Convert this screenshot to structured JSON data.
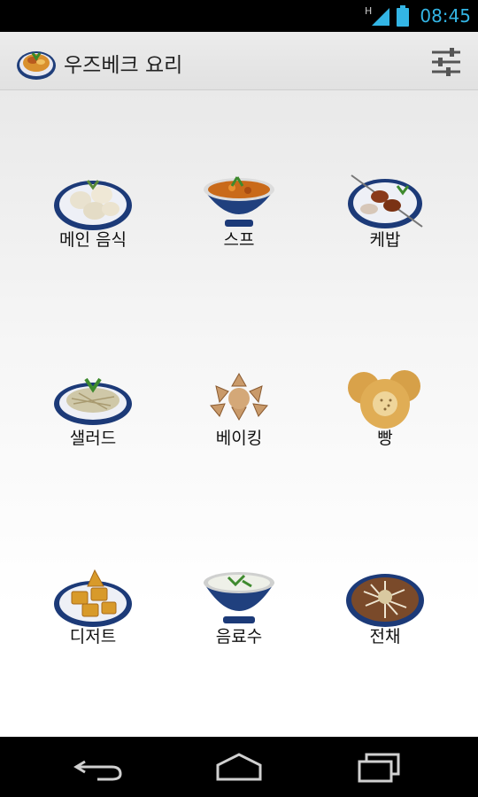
{
  "status_bar": {
    "network_label": "H",
    "time": "08:45",
    "icons": [
      "signal-icon",
      "battery-icon"
    ],
    "accent_color": "#33b5e5"
  },
  "action_bar": {
    "title": "우즈베크 요리",
    "app_icon": "plov-dish-icon",
    "settings_icon": "sliders-icon"
  },
  "categories": [
    {
      "label": "메인 음식",
      "icon": "dumplings-plate-icon"
    },
    {
      "label": "스프",
      "icon": "soup-bowl-icon"
    },
    {
      "label": "케밥",
      "icon": "kebab-plate-icon"
    },
    {
      "label": "샐러드",
      "icon": "salad-plate-icon"
    },
    {
      "label": "베이킹",
      "icon": "pastries-icon"
    },
    {
      "label": "빵",
      "icon": "bread-icon"
    },
    {
      "label": "디저트",
      "icon": "dessert-plate-icon"
    },
    {
      "label": "음료수",
      "icon": "drink-bowl-icon"
    },
    {
      "label": "전채",
      "icon": "appetizer-plate-icon"
    }
  ],
  "nav_bar": {
    "buttons": [
      "back-icon",
      "home-icon",
      "recent-apps-icon"
    ]
  }
}
